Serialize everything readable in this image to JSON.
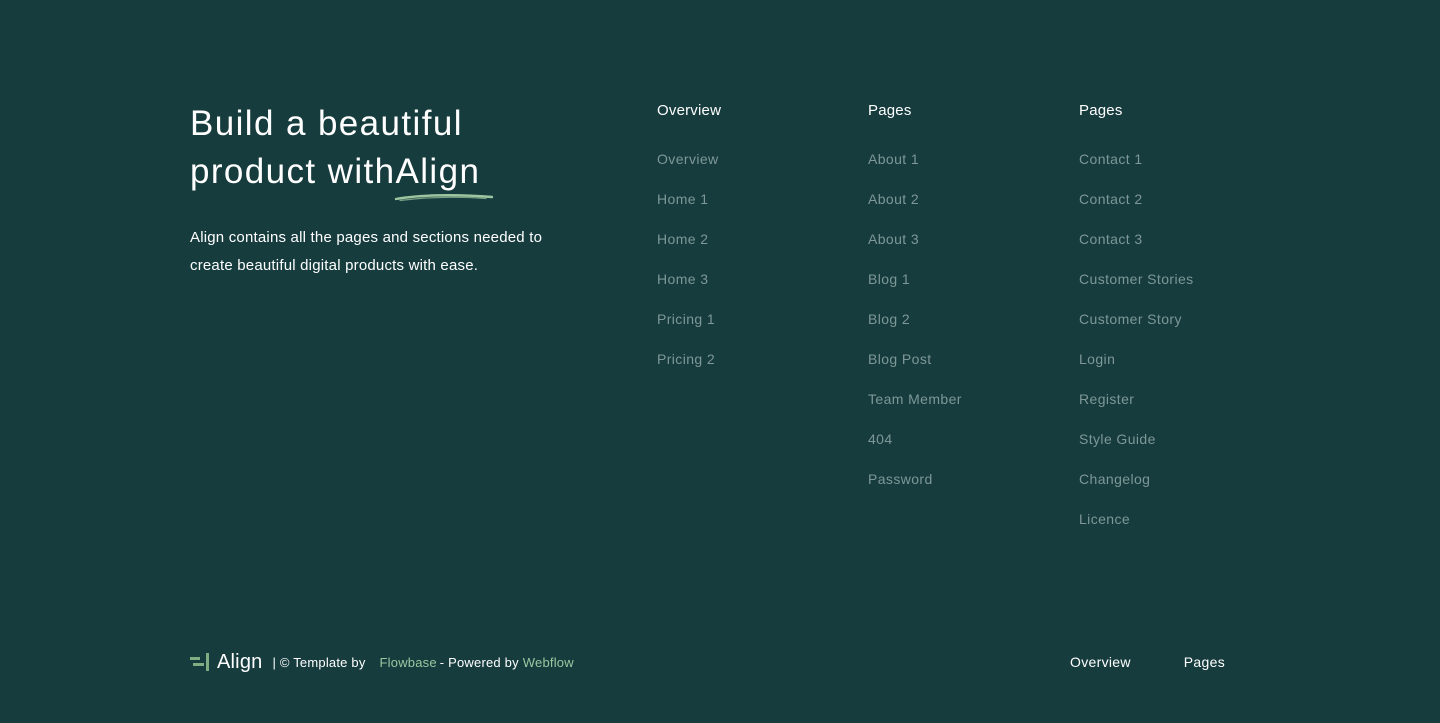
{
  "hero": {
    "headline_line1": "Build a beautiful",
    "headline_line2_prefix": "product with",
    "headline_brand": "Align",
    "description": "Align contains all the pages and sections needed to create beautiful digital products with ease."
  },
  "columns": [
    {
      "title": "Overview",
      "links": [
        "Overview",
        "Home 1",
        "Home 2",
        "Home 3",
        "Pricing 1",
        "Pricing 2"
      ]
    },
    {
      "title": "Pages",
      "links": [
        "About 1",
        "About 2",
        "About 3",
        "Blog 1",
        "Blog 2",
        "Blog Post",
        "Team Member",
        "404",
        "Password"
      ]
    },
    {
      "title": "Pages",
      "links": [
        "Contact 1",
        "Contact 2",
        "Contact 3",
        "Customer Stories",
        "Customer Story",
        "Login",
        "Register",
        "Style Guide",
        "Changelog",
        "Licence"
      ]
    }
  ],
  "footer": {
    "logo_text": "Align",
    "credit_prefix": "| © Template by",
    "flowbase_link": "Flowbase",
    "credit_middle": "- Powered by",
    "webflow_link": "Webflow",
    "nav": [
      "Overview",
      "Pages"
    ]
  },
  "colors": {
    "background": "#163c3e",
    "muted_link": "#7e9797",
    "accent_green": "#9dc6a0"
  },
  "icons": {
    "logo": "align-logo-icon",
    "underline": "brush-underline"
  }
}
